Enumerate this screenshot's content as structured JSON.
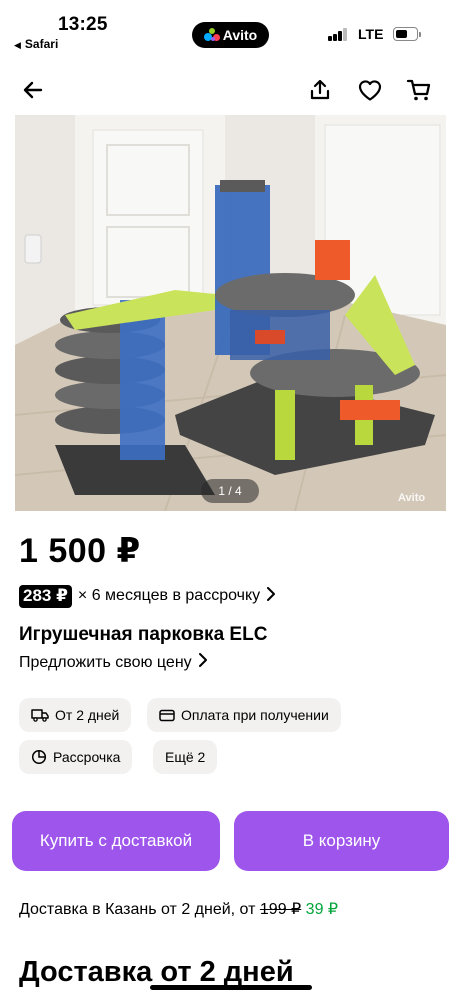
{
  "status_bar": {
    "time": "13:25",
    "back_app": "Safari",
    "app_name": "Avito",
    "network": "LTE"
  },
  "nav": {
    "back_icon": "arrow-left-icon",
    "share_icon": "share-icon",
    "favorite_icon": "heart-icon",
    "cart_icon": "cart-icon"
  },
  "gallery": {
    "counter": "1 / 4",
    "watermark": "Avito"
  },
  "listing": {
    "price": "1 500 ₽",
    "installment_amount": "283 ₽",
    "installment_text": "× 6 месяцев в рассрочку",
    "title": "Игрушечная парковка ELC",
    "offer_price": "Предложить свою цену"
  },
  "chips": {
    "delivery_time": "От 2 дней",
    "payment_on_receipt": "Оплата при получении",
    "installment": "Рассрочка",
    "more": "Ещё 2"
  },
  "actions": {
    "buy_with_delivery": "Купить с доставкой",
    "add_to_cart": "В корзину"
  },
  "delivery": {
    "prefix": "Доставка в Казань от 2 дней, от",
    "old_price": "199 ₽",
    "new_price": "39 ₽",
    "section_title": "Доставка от 2 дней"
  },
  "colors": {
    "accent_purple": "#9e55ec",
    "price_green": "#02a53c",
    "chip_background": "#f2f1f0"
  }
}
